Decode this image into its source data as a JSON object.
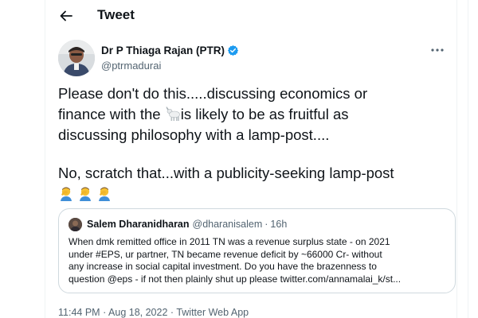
{
  "header": {
    "title": "Tweet",
    "back_icon": "arrow-left-icon"
  },
  "author": {
    "name": "Dr P Thiaga Rajan (PTR)",
    "handle": "@ptrmadurai",
    "verified": true,
    "verified_color": "#1d9bf0"
  },
  "tweet": {
    "line1": "Please don't do this.....discussing economics or",
    "line2_before": "finance with the ",
    "line2_emoji": "goat-icon",
    "line2_after": "is likely to be as fruitful as",
    "line3": "discussing philosophy with a lamp-post....",
    "line4": "No, scratch that...with a publicity-seeking lamp-post",
    "trailing_emojis": [
      "man-facepalming-icon",
      "man-facepalming-icon",
      "man-facepalming-icon"
    ]
  },
  "quote": {
    "name": "Salem Dharanidharan",
    "handle": "@dharanisalem",
    "separator": "·",
    "time": "16h",
    "lines": [
      "When dmk remitted office  in 2011 TN was a revenue surplus state - on 2021",
      "under  #EPS, ur partner, TN became   revenue deficit by ~66000 Cr- without",
      "any increase in social capital investment. Do you have the brazenness to",
      "question @eps - if not then plainly shut up please twitter.com/annamalai_k/st..."
    ]
  },
  "meta": {
    "time": "11:44 PM",
    "date": "Aug 18, 2022",
    "source": "Twitter Web App",
    "separator": "·"
  },
  "colors": {
    "text": "#0f1419",
    "secondary": "#536471",
    "border": "#cfd9de",
    "accent": "#1d9bf0"
  }
}
